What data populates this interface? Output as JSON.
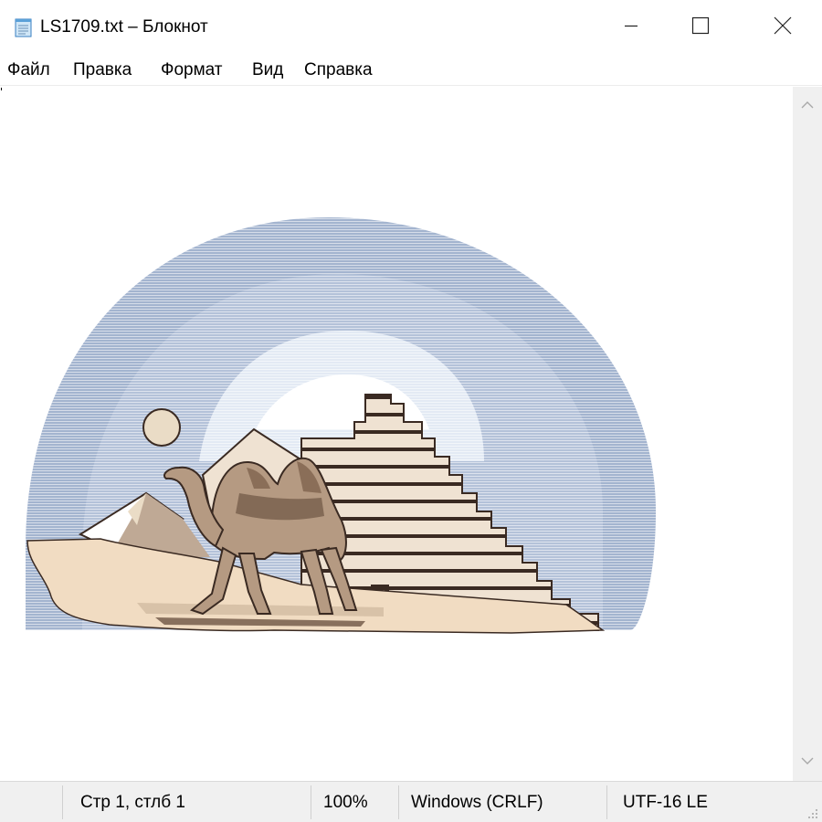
{
  "window": {
    "title": "LS1709.txt – Блокнот",
    "icon": "notepad-icon",
    "controls": [
      "minimize-icon",
      "maximize-icon",
      "close-icon"
    ]
  },
  "menu": {
    "items": [
      {
        "label": "Файл"
      },
      {
        "label": "Правка"
      },
      {
        "label": "Формат"
      },
      {
        "label": "Вид"
      },
      {
        "label": "Справка"
      }
    ]
  },
  "editor": {
    "content": "ASCII-art picture: camel standing in front of a stepped pyramid and a small pyramid, with a sun and a pale blue arc in the sky",
    "colors": {
      "sky_outer": "#a3b4cf",
      "sky_inner": "#c8d3e6",
      "sky_core": "#e8eef6",
      "sand": "#f1dcc2",
      "pyramid": "#efe2d2",
      "pyramid_dark": "#3a2a22",
      "camel": "#b59a82",
      "camel_dark": "#6e5543",
      "sun": "#eadcc6"
    }
  },
  "scrollbar": {
    "up_icon": "chevron-up-icon",
    "down_icon": "chevron-down-icon"
  },
  "status": {
    "position": "Стр 1, стлб 1",
    "zoom": "100%",
    "line_endings": "Windows (CRLF)",
    "encoding": "UTF-16 LE"
  }
}
